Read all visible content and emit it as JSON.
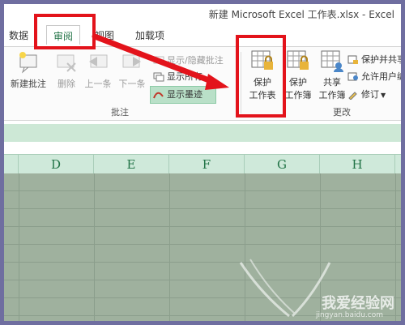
{
  "window": {
    "title": "新建 Microsoft Excel 工作表.xlsx - Excel"
  },
  "tabs": [
    {
      "label": "数据"
    },
    {
      "label": "审阅"
    },
    {
      "label": "视图"
    },
    {
      "label": "加载项"
    }
  ],
  "comments_group": {
    "label": "批注",
    "new_comment": "新建批注",
    "delete": "删除",
    "previous": "上一条",
    "next": "下一条",
    "show_hide": "显示/隐藏批注",
    "show_all": "显示所有",
    "show_ink": "显示墨迹"
  },
  "changes_group": {
    "label": "更改",
    "protect_sheet": [
      "保护",
      "工作表"
    ],
    "protect_workbook": [
      "保护",
      "工作簿"
    ],
    "share_workbook": [
      "共享",
      "工作簿"
    ],
    "protect_and_share": "保护并共享",
    "allow_users": "允许用户编",
    "track_changes": "修订"
  },
  "columns": [
    "D",
    "E",
    "F",
    "G",
    "H"
  ],
  "watermark": {
    "text": "我爱经验网",
    "sub": "jingyan.baidu.com"
  },
  "colors": {
    "accent": "#217346",
    "highlight": "#e3131b",
    "sheet_bg": "#9fb19e"
  }
}
